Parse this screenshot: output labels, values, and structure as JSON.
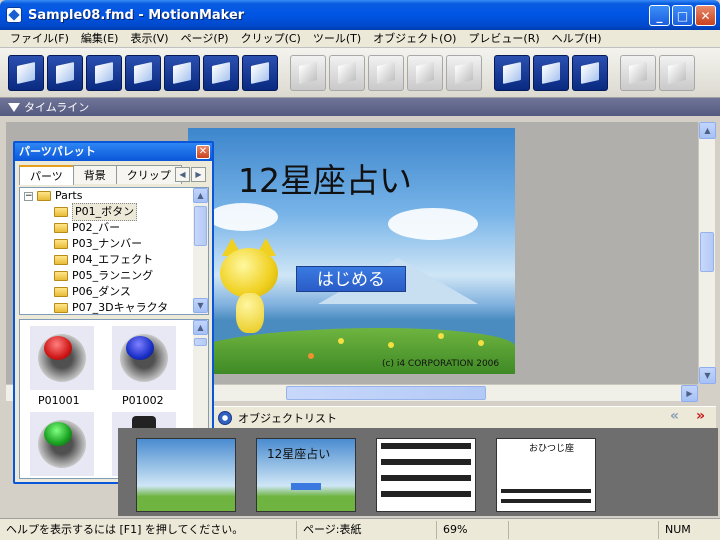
{
  "window": {
    "title": "Sample08.fmd - MotionMaker"
  },
  "menu": [
    "ファイル(F)",
    "編集(E)",
    "表示(V)",
    "ページ(P)",
    "クリップ(C)",
    "ツール(T)",
    "オブジェクト(O)",
    "プレビュー(R)",
    "ヘルプ(H)"
  ],
  "timeline": {
    "label": "タイムライン"
  },
  "stage": {
    "title": "12星座占い",
    "start_button": "はじめる",
    "copyright": "(c) i4 CORPORATION 2006"
  },
  "palette": {
    "title": "パーツパレット",
    "tabs": [
      "パーツ",
      "背景",
      "クリップ"
    ],
    "tree": {
      "root": "Parts",
      "items": [
        "P01_ボタン",
        "P02_バー",
        "P03_ナンバー",
        "P04_エフェクト",
        "P05_ランニング",
        "P06_ダンス",
        "P07_3Dキャラクタ"
      ]
    },
    "thumbs": [
      {
        "label": "P01001",
        "color": "#d01818"
      },
      {
        "label": "P01002",
        "color": "#1a30c8"
      },
      {
        "label": "",
        "color": "#18a020"
      },
      {
        "label": "",
        "color": "#c81818"
      }
    ]
  },
  "pages_panel": {
    "object_list_label": "オブジェクトリスト",
    "thumb_title": "12星座占い",
    "thumb4_title": "おひつじ座"
  },
  "statusbar": {
    "help": "ヘルプを表示するには [F1] を押してください。",
    "page": "ページ:表紙",
    "zoom": "69%",
    "num": "NUM"
  }
}
